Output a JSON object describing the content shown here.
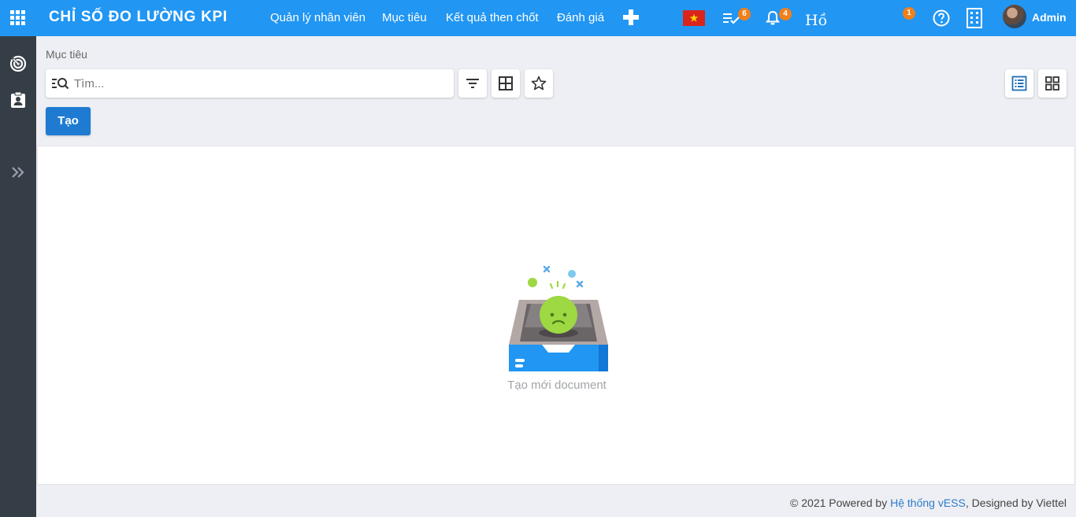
{
  "app": {
    "title": "CHỈ SỐ ĐO LƯỜNG KPI"
  },
  "nav": {
    "items": [
      {
        "label": "Quản lý nhân viên"
      },
      {
        "label": "Mục tiêu"
      },
      {
        "label": "Kết quả then chốt"
      },
      {
        "label": "Đánh giá"
      }
    ],
    "tasks_badge": "6",
    "notifications_badge": "4",
    "ho_text": "Hồ",
    "activity_badge": "1",
    "user_name": "Admin",
    "icons": [
      "apps-grid-icon",
      "plus-icon",
      "vietnam-flag-icon",
      "task-list-icon",
      "bell-icon",
      "help-icon",
      "building-icon"
    ]
  },
  "sidebar": {
    "icons": [
      "target-icon",
      "clipboard-user-icon",
      "expand-chevrons-icon"
    ]
  },
  "main": {
    "breadcrumb": "Mục tiêu",
    "search": {
      "placeholder": "Tìm..."
    },
    "toolbar": {
      "icons": [
        "filter-icon",
        "group-by-icon",
        "favorite-star-icon",
        "list-view-icon",
        "kanban-view-icon"
      ]
    },
    "create_label": "Tạo",
    "empty_state": "Tạo mới document"
  },
  "footer": {
    "prefix": "© 2021 Powered by ",
    "link": "Hệ thống vESS",
    "suffix": ", Designed by Viettel"
  },
  "colors": {
    "navbar": "#2196f3",
    "sidebar": "#353e47",
    "primary_button": "#1f7bd2",
    "badge": "#f0801a",
    "background": "#eeeff4"
  }
}
